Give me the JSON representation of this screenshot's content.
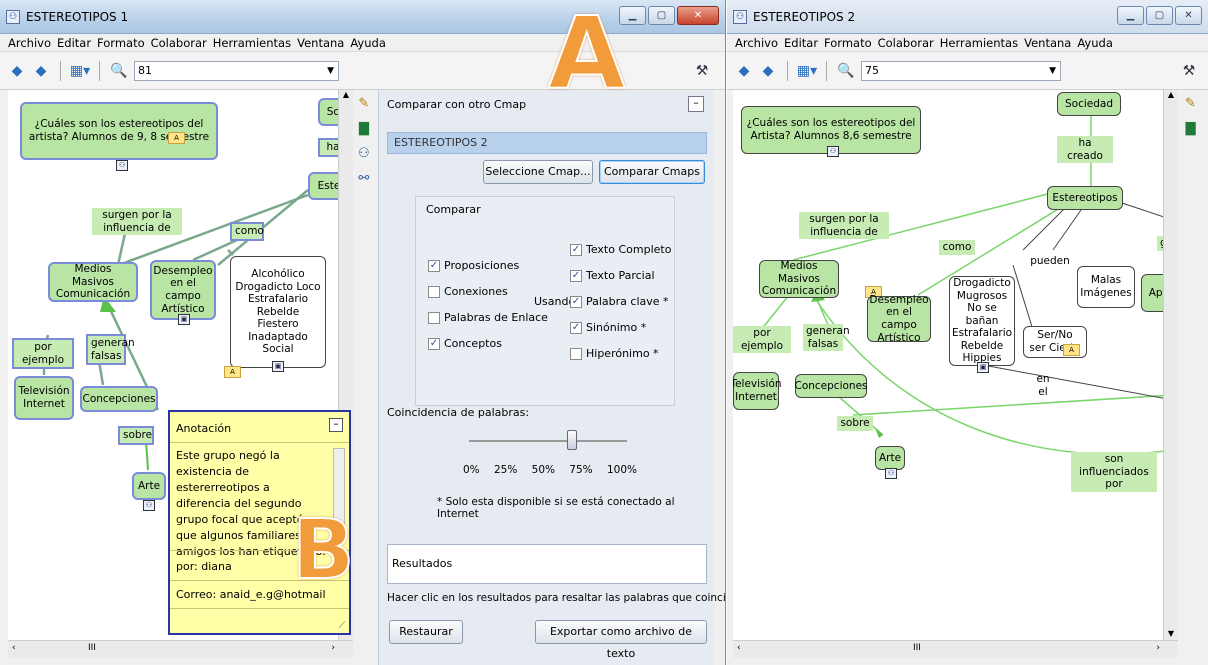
{
  "window1": {
    "title": "ESTEREOTIPOS 1",
    "menu": [
      "Archivo",
      "Editar",
      "Formato",
      "Colaborar",
      "Herramientas",
      "Ventana",
      "Ayuda"
    ],
    "zoom": "81",
    "map": {
      "question": "¿Cuáles son los estereotipos del artista? Alumnos de 9, 8 semestre",
      "nodes": {
        "medios": "Medios Masivos Comunicación",
        "desempleo": "Desempleo en el campo Artístico",
        "alcoholico": "Alcohólico Drogadicto Loco Estrafalario Rebelde Fiestero Inadaptado Social",
        "television": "Televisión Internet",
        "concepciones": "Concepciones",
        "arte": "Arte",
        "sc": "Sc",
        "ha": "ha",
        "este": "Este"
      },
      "links": {
        "surgen": "surgen por la influencia de",
        "como": "como",
        "por_ejemplo": "por ejemplo",
        "generan": "generan falsas",
        "sobre": "sobre"
      }
    },
    "annotation": {
      "title": "Anotación",
      "minimize": "–",
      "text": "Este grupo negó la existencia de estererreotipos a diferencia del segundo grupo focal que aceptó que algunos familiares y amigos los han etiquetado.",
      "author": "por: diana",
      "email": "Correo: anaid_e.g@hotmail"
    },
    "compare_panel": {
      "title": "Comparar con otro Cmap",
      "minimize": "–",
      "selected_map": "ESTEREOTIPOS 2",
      "select_button": "Seleccione Cmap...",
      "compare_button": "Comparar Cmaps",
      "group_label": "Comparar",
      "compare_items": [
        {
          "label": "Proposiciones",
          "checked": true
        },
        {
          "label": "Conexiones",
          "checked": false
        },
        {
          "label": "Palabras de Enlace",
          "checked": false
        },
        {
          "label": "Conceptos",
          "checked": true
        }
      ],
      "using_label": "Usando:",
      "using_items": [
        {
          "label": "Texto Completo",
          "checked": true
        },
        {
          "label": "Texto Parcial",
          "checked": true
        },
        {
          "label": "Palabra clave *",
          "checked": true
        },
        {
          "label": "Sinónimo *",
          "checked": true
        },
        {
          "label": "Hiperónimo *",
          "checked": false
        }
      ],
      "match_label": "Coincidencia de palabras:",
      "slider_value_pct": 65,
      "slider_ticks": [
        "0%",
        "25%",
        "50%",
        "75%",
        "100%"
      ],
      "note": "* Solo esta disponible si se está conectado al Internet",
      "results_label": "Resultados",
      "hint": "Hacer clic en los resultados para resaltar las palabras que coinciden en los Cma",
      "restore_button": "Restaurar",
      "export_button": "Exportar como archivo de texto"
    },
    "scroll_arrow_left": "‹",
    "scroll_arrow_right": "›",
    "scroll_grip": "III"
  },
  "window2": {
    "title": "ESTEREOTIPOS 2",
    "menu": [
      "Archivo",
      "Editar",
      "Formato",
      "Colaborar",
      "Herramientas",
      "Ventana",
      "Ayuda"
    ],
    "zoom": "75",
    "map": {
      "question": "¿Cuáles son los estereotipos del Artista? Alumnos 8,6 semestre",
      "nodes": {
        "sociedad": "Sociedad",
        "estereotipos": "Estereotipos",
        "medios": "Medios Masivos Comunicación",
        "desempleo": "Desempleo en el campo Artístico",
        "drogadicto": "Drogadicto Mugrosos No se bañan Estrafalario Rebelde Hippies",
        "malas": "Malas Imágenes",
        "apar": "Apar",
        "sernoser": "Ser/No ser Cierta",
        "television": "Televisión Internet",
        "concepciones": "Concepciones",
        "arte": "Arte"
      },
      "links": {
        "ha_creado": "ha creado",
        "surgen": "surgen por la influencia de",
        "como": "como",
        "pueden": "pueden",
        "gen": "gen",
        "por_ejemplo": "por ejemplo",
        "generan": "generan falsas",
        "en_el": "en el",
        "sobre": "sobre",
        "son_influenciados": "son influenciados por",
        "s": "s"
      }
    },
    "scroll_arrow_left": "‹",
    "scroll_arrow_right": "›",
    "scroll_grip": "III"
  },
  "callouts": {
    "a": "A",
    "b": "B"
  },
  "colors": {
    "concept_fill": "#b8e4a4",
    "concept_border": "#7b8bd8",
    "link_line": "#6ec85a",
    "annotation_fill": "#ffffa8",
    "callout": "#f29b3a"
  }
}
